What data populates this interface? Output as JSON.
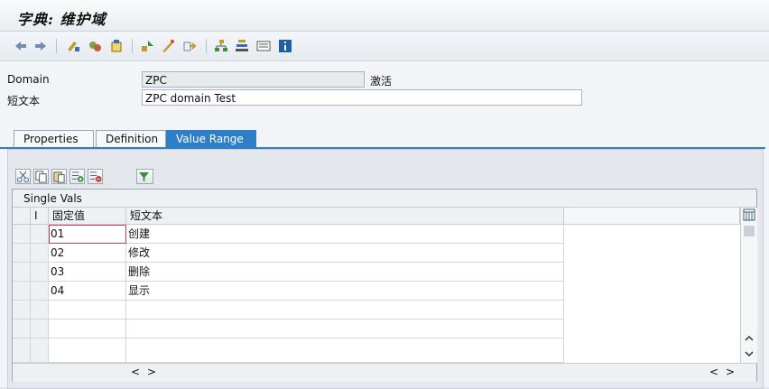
{
  "window": {
    "title": "字典: 维护域"
  },
  "toolbar": {
    "icons": [
      "back-arrow-icon",
      "forward-arrow-icon",
      "display-change-icon",
      "other-object-icon",
      "activate-icon",
      "where-used-icon",
      "edit-object-icon",
      "navigate-icon",
      "hierarchy-icon",
      "tree-icon",
      "layout-icon",
      "info-icon"
    ]
  },
  "form": {
    "domain_label": "Domain",
    "domain_value": "ZPC",
    "domain_status": "激活",
    "short_text_label": "短文本",
    "short_text_value": "ZPC domain Test"
  },
  "tabs": [
    {
      "label": "Properties",
      "active": false
    },
    {
      "label": "Definition",
      "active": false
    },
    {
      "label": "Value Range",
      "active": true
    }
  ],
  "table": {
    "section_title": "Single Vals",
    "headers": {
      "indicator": "I",
      "fixed_value": "固定值",
      "short_text": "短文本"
    },
    "rows": [
      {
        "value": "01",
        "text": "创建"
      },
      {
        "value": "02",
        "text": "修改"
      },
      {
        "value": "03",
        "text": "删除"
      },
      {
        "value": "04",
        "text": "显示"
      },
      {
        "value": "",
        "text": ""
      },
      {
        "value": "",
        "text": ""
      },
      {
        "value": "",
        "text": ""
      }
    ]
  },
  "scroll": {
    "left": "<",
    "right": ">"
  },
  "colors": {
    "active_tab": "#2f7fc8",
    "toolbar_bg": "#e6ebf0"
  }
}
